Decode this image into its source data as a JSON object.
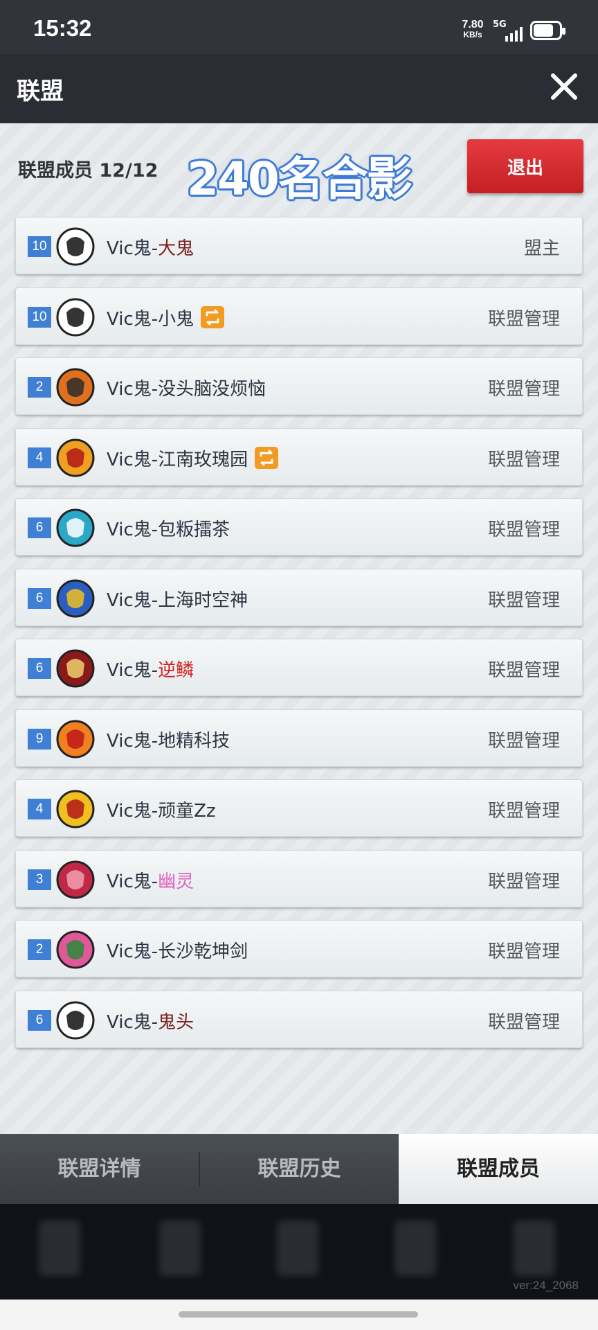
{
  "status_bar": {
    "time": "15:32",
    "net_speed": "7.80",
    "net_unit": "KB/s",
    "network": "5G",
    "battery_icon": "battery-icon",
    "signal_icon": "signal-icon"
  },
  "header": {
    "title": "联盟",
    "close_icon": "close-icon"
  },
  "summary": {
    "member_count_label": "联盟成员 12/12",
    "banner_text": "240名合影",
    "exit_label": "退出"
  },
  "colors": {
    "level_badge": "#3f7fd4",
    "exit_button": "#d62a2f",
    "swap_icon": "#f39a22"
  },
  "members": [
    {
      "level": "10",
      "prefix": "Vic鬼-",
      "nickname": "大鬼",
      "nickname_color": "#7a2020",
      "role": "盟主",
      "swap_icon": false,
      "emblem": "panda-emblem"
    },
    {
      "level": "10",
      "prefix": "Vic鬼-",
      "nickname": "小鬼",
      "nickname_color": "#2c3440",
      "role": "联盟管理",
      "swap_icon": true,
      "emblem": "panda-emblem"
    },
    {
      "level": "2",
      "prefix": "Vic鬼-",
      "nickname": "没头脑没烦恼",
      "nickname_color": "#2c3440",
      "role": "联盟管理",
      "swap_icon": false,
      "emblem": "knight-shield-emblem"
    },
    {
      "level": "4",
      "prefix": "Vic鬼-",
      "nickname": "江南玫瑰园",
      "nickname_color": "#2c3440",
      "role": "联盟管理",
      "swap_icon": true,
      "emblem": "boar-emblem"
    },
    {
      "level": "6",
      "prefix": "Vic鬼-",
      "nickname": "包粄擂茶",
      "nickname_color": "#2c3440",
      "role": "联盟管理",
      "swap_icon": false,
      "emblem": "hexagon-emblem"
    },
    {
      "level": "6",
      "prefix": "Vic鬼-",
      "nickname": "上海时空神",
      "nickname_color": "#2c3440",
      "role": "联盟管理",
      "swap_icon": false,
      "emblem": "eagle-emblem"
    },
    {
      "level": "6",
      "prefix": "Vic鬼-",
      "nickname": "逆鳞",
      "nickname_color": "#d42020",
      "role": "联盟管理",
      "swap_icon": false,
      "emblem": "dragon-emblem"
    },
    {
      "level": "9",
      "prefix": "Vic鬼-",
      "nickname": "地精科技",
      "nickname_color": "#2c3440",
      "role": "联盟管理",
      "swap_icon": false,
      "emblem": "bull-emblem"
    },
    {
      "level": "4",
      "prefix": "Vic鬼-",
      "nickname": "顽童Zz",
      "nickname_color": "#2c3440",
      "role": "联盟管理",
      "swap_icon": false,
      "emblem": "spartan-emblem"
    },
    {
      "level": "3",
      "prefix": "Vic鬼-",
      "nickname": "幽灵",
      "nickname_color": "#e060c0",
      "role": "联盟管理",
      "swap_icon": false,
      "emblem": "star-emblem"
    },
    {
      "level": "2",
      "prefix": "Vic鬼-",
      "nickname": "长沙乾坤剑",
      "nickname_color": "#2c3440",
      "role": "联盟管理",
      "swap_icon": false,
      "emblem": "orc-emblem"
    },
    {
      "level": "6",
      "prefix": "Vic鬼-",
      "nickname": "鬼头",
      "nickname_color": "#7a2020",
      "role": "联盟管理",
      "swap_icon": false,
      "emblem": "skull-emblem"
    }
  ],
  "tabs": [
    {
      "label": "联盟详情",
      "active": false
    },
    {
      "label": "联盟历史",
      "active": false
    },
    {
      "label": "联盟成员",
      "active": true
    }
  ],
  "footer": {
    "version": "ver:24_2068"
  }
}
